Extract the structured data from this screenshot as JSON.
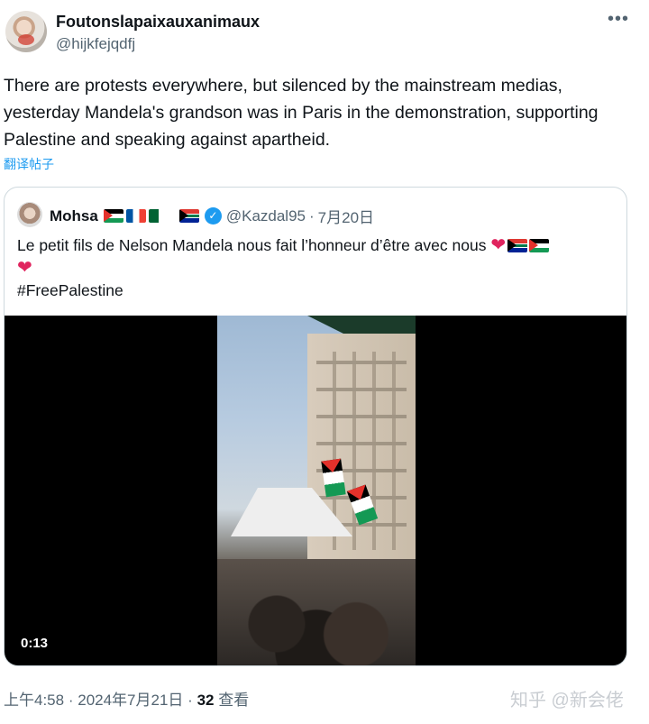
{
  "tweet": {
    "display_name": "Foutonslapaixauxanimaux",
    "handle": "@hijkfejqdfj",
    "more_icon": "ellipsis-icon",
    "text": "There are protests everywhere, but silenced by the mainstream medias, yesterday Mandela's grandson was in Paris in the demonstration, supporting Palestine and speaking against apartheid.",
    "translate_label": "翻译帖子"
  },
  "quote": {
    "name": "Mohsa",
    "name_flags": [
      "palestine-flag",
      "france-flag",
      "algeria-flag",
      "south-africa-flag"
    ],
    "verified_icon": "verified-badge-icon",
    "handle": "@Kazdal95",
    "separator": "·",
    "date": "7月20日",
    "text_line1": "Le petit fils de Nelson Mandela nous fait l’honneur d’être avec nous",
    "text_hashtag": "#FreePalestine",
    "video": {
      "timestamp": "0:13"
    }
  },
  "footer": {
    "time": "上午4:58",
    "separator": "·",
    "date": "2024年7月21日",
    "views_count": "32",
    "views_label": "查看"
  },
  "watermark": "知乎 @新会佬",
  "colors": {
    "accent": "#1d9bf0",
    "text": "#0f1419",
    "secondary_text": "#536471",
    "heart": "#e0245e",
    "border": "#cfd9de"
  }
}
